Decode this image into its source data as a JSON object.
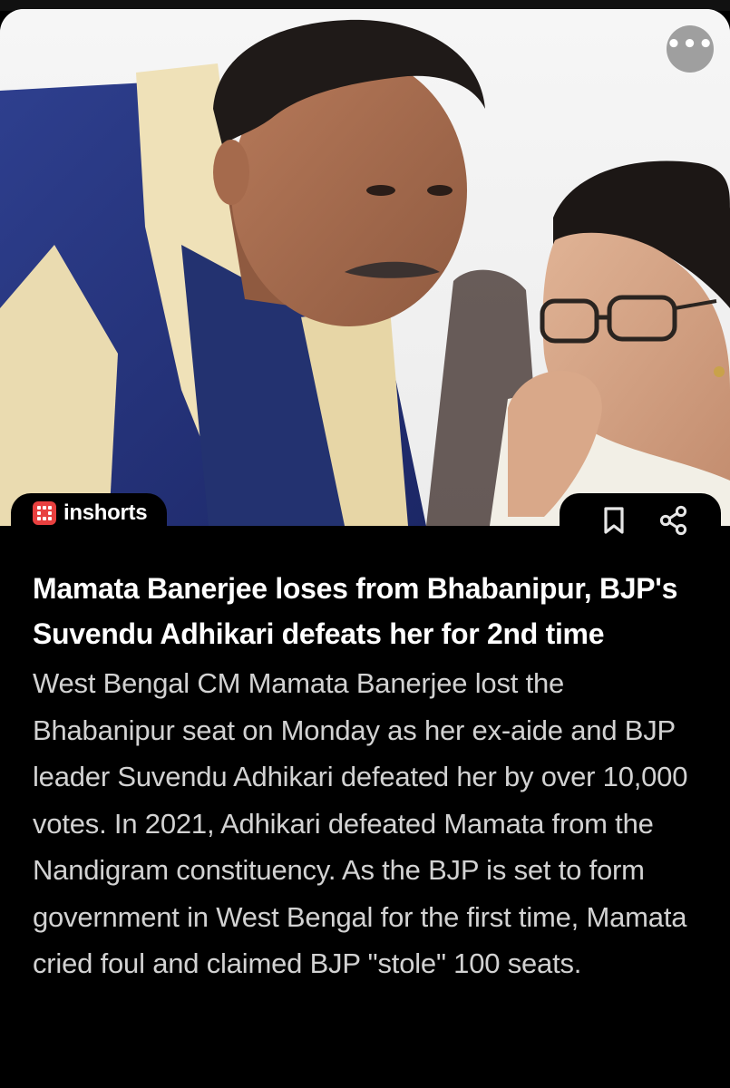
{
  "photo": {
    "alt_subject": "news-photo"
  },
  "more_menu": {
    "icon": "more-horizontal-icon",
    "label": "•••"
  },
  "brand": {
    "name": "inshorts",
    "logo_color": "#e8403f"
  },
  "actions": {
    "bookmark_icon": "bookmark-icon",
    "share_icon": "share-icon"
  },
  "article": {
    "headline": "Mamata Banerjee loses from Bhabanipur, BJP's Suvendu Adhikari defeats her for 2nd time",
    "body": "West Bengal CM Mamata Banerjee lost the Bhabanipur seat on Monday as her ex-aide and BJP leader Suvendu Adhikari defeated her by over 10,000 votes. In 2021, Adhikari defeated Mamata from the Nandigram constituency. As the BJP is set to form government in West Bengal for the first time, Mamata cried foul and claimed BJP \"stole\" 100 seats."
  },
  "colors": {
    "background": "#000000",
    "headline": "#ffffff",
    "body": "#d2d2d2",
    "accent": "#e8403f"
  }
}
